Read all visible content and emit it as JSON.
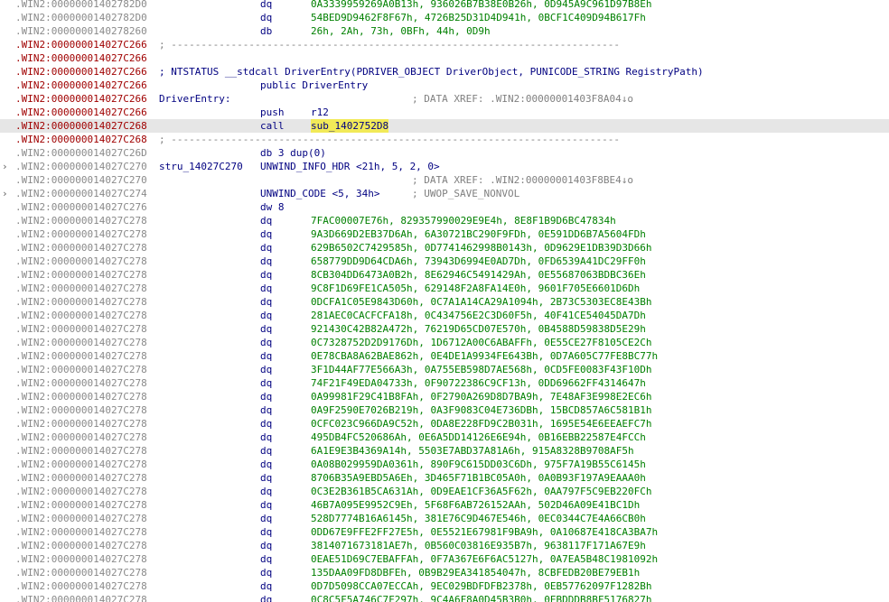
{
  "colors": {
    "background": "#ffffff",
    "address_gray": "#8a8a8a",
    "address_red": "#a00000",
    "code_navy": "#000080",
    "data_green": "#008000",
    "comment_gray": "#808080",
    "highlight_yellow": "#f2ea58",
    "current_line": "#e6e6e6"
  },
  "icons": {
    "expand": "chevron-right-icon"
  },
  "listing": [
    {
      "addr": ".WIN2:00000001402782D0",
      "mnem": "dq",
      "ops": "0A3339959269A0B13h, 936026B7B38E0B26h, 0D945A9C961D97B8Eh"
    },
    {
      "addr": ".WIN2:00000001402782D0",
      "mnem": "dq",
      "ops": "54BED9D9462F8F67h, 4726B25D31D4D941h, 0BCF1C409D94B617Fh"
    },
    {
      "addr": ".WIN2:0000000140278260",
      "mnem": "db",
      "ops": "26h, 2Ah, 73h, 0BFh, 44h, 0D9h"
    },
    {
      "addr": ".WIN2:000000014027C266",
      "addr_red": true,
      "label": "; ---------------------------------------------------------------------------",
      "label_comment": true
    },
    {
      "addr": ".WIN2:000000014027C266",
      "addr_red": true
    },
    {
      "addr": ".WIN2:000000014027C266",
      "addr_red": true,
      "label": "; NTSTATUS __stdcall DriverEntry(PDRIVER_OBJECT DriverObject, PUNICODE_STRING RegistryPath)"
    },
    {
      "addr": ".WIN2:000000014027C266",
      "addr_red": true,
      "mnem": "public DriverEntry"
    },
    {
      "addr": ".WIN2:000000014027C266",
      "addr_red": true,
      "label": "DriverEntry:",
      "cmt": "; DATA XREF: .WIN2:00000001403F8A04↓o"
    },
    {
      "addr": ".WIN2:000000014027C266",
      "addr_red": true,
      "mnem": "push",
      "ops": "r12",
      "ops_navy": true
    },
    {
      "addr": ".WIN2:000000014027C268",
      "addr_red": true,
      "mnem": "call",
      "ops": "sub_1402752D8",
      "ops_hl": true,
      "current": true
    },
    {
      "addr": ".WIN2:000000014027C268",
      "addr_red": true,
      "label": "; ---------------------------------------------------------------------------",
      "label_comment": true
    },
    {
      "addr": ".WIN2:000000014027C26D",
      "mnem": "db 3 dup(0)"
    },
    {
      "addr": ".WIN2:000000014027C270",
      "arrow": true,
      "label": "stru_14027C270",
      "mnem": "UNWIND_INFO_HDR <21h, 5, 2, 0>"
    },
    {
      "addr": ".WIN2:000000014027C270",
      "cmt": "; DATA XREF: .WIN2:00000001403F8BE4↓o"
    },
    {
      "addr": ".WIN2:000000014027C274",
      "arrow": true,
      "mnem": "UNWIND_CODE <5, 34h>",
      "cmt": "; UWOP_SAVE_NONVOL"
    },
    {
      "addr": ".WIN2:000000014027C276",
      "mnem": "dw 8"
    },
    {
      "addr": ".WIN2:000000014027C278",
      "mnem": "dq",
      "ops": "7FAC00007E76h, 829357990029E9E4h, 8E8F1B9D6BC47834h"
    },
    {
      "addr": ".WIN2:000000014027C278",
      "mnem": "dq",
      "ops": "9A3D669D2EB37D6Ah, 6A30721BC290F9FDh, 0E591DD6B7A5604FDh"
    },
    {
      "addr": ".WIN2:000000014027C278",
      "mnem": "dq",
      "ops": "629B6502C7429585h, 0D7741462998B0143h, 0D9629E1DB39D3D66h"
    },
    {
      "addr": ".WIN2:000000014027C278",
      "mnem": "dq",
      "ops": "658779DD9D64CDA6h, 73943D6994E0AD7Dh, 0FD6539A41DC29FF0h"
    },
    {
      "addr": ".WIN2:000000014027C278",
      "mnem": "dq",
      "ops": "8CB304DD6473A0B2h, 8E62946C5491429Ah, 0E55687063BDBC36Eh"
    },
    {
      "addr": ".WIN2:000000014027C278",
      "mnem": "dq",
      "ops": "9C8F1D69FE1CA505h, 629148F2A8FA14E0h, 9601F705E6601D6Dh"
    },
    {
      "addr": ".WIN2:000000014027C278",
      "mnem": "dq",
      "ops": "0DCFA1C05E9843D60h, 0C7A1A14CA29A1094h, 2B73C5303EC8E43Bh"
    },
    {
      "addr": ".WIN2:000000014027C278",
      "mnem": "dq",
      "ops": "281AEC0CACFCFA18h, 0C434756E2C3D60F5h, 40F41CE54045DA7Dh"
    },
    {
      "addr": ".WIN2:000000014027C278",
      "mnem": "dq",
      "ops": "921430C42B82A472h, 76219D65CD07E570h, 0B4588D59838D5E29h"
    },
    {
      "addr": ".WIN2:000000014027C278",
      "mnem": "dq",
      "ops": "0C7328752D2D9176Dh, 1D6712A00C6ABAFFh, 0E55CE27F8105CE2Ch"
    },
    {
      "addr": ".WIN2:000000014027C278",
      "mnem": "dq",
      "ops": "0E78CBA8A62BAE862h, 0E4DE1A9934FE643Bh, 0D7A605C77FE8BC77h"
    },
    {
      "addr": ".WIN2:000000014027C278",
      "mnem": "dq",
      "ops": "3F1D44AF77E566A3h, 0A755EB598D7AE568h, 0CD5FE0083F43F10Dh"
    },
    {
      "addr": ".WIN2:000000014027C278",
      "mnem": "dq",
      "ops": "74F21F49EDA04733h, 0F90722386C9CF13h, 0DD69662FF4314647h"
    },
    {
      "addr": ".WIN2:000000014027C278",
      "mnem": "dq",
      "ops": "0A99981F29C41B8FAh, 0F2790A269D8D7BA9h, 7E48AF3E998E2EC6h"
    },
    {
      "addr": ".WIN2:000000014027C278",
      "mnem": "dq",
      "ops": "0A9F2590E7026B219h, 0A3F9083C04E736DBh, 15BCD857A6C581B1h"
    },
    {
      "addr": ".WIN2:000000014027C278",
      "mnem": "dq",
      "ops": "0CFC023C966DA9C52h, 0DA8E228FD9C2B031h, 1695E54E6EEAEFC7h"
    },
    {
      "addr": ".WIN2:000000014027C278",
      "mnem": "dq",
      "ops": "495DB4FC520686Ah, 0E6A5DD14126E6E94h, 0B16EBB22587E4FCCh"
    },
    {
      "addr": ".WIN2:000000014027C278",
      "mnem": "dq",
      "ops": "6A1E9E3B4369A14h, 5503E7ABD37A81A6h, 915A8328B9708AF5h"
    },
    {
      "addr": ".WIN2:000000014027C278",
      "mnem": "dq",
      "ops": "0A08B029959DA0361h, 890F9C615DD03C6Dh, 975F7A19B55C6145h"
    },
    {
      "addr": ".WIN2:000000014027C278",
      "mnem": "dq",
      "ops": "8706B35A9EBD5A6Eh, 3D465F71B1BC05A0h, 0A0B93F197A9EAAA0h"
    },
    {
      "addr": ".WIN2:000000014027C278",
      "mnem": "dq",
      "ops": "0C3E2B361B5CA631Ah, 0D9EAE1CF36A5F62h, 0AA797F5C9EB220FCh"
    },
    {
      "addr": ".WIN2:000000014027C278",
      "mnem": "dq",
      "ops": "46B7A095E9952C9Eh, 5F68F6AB726152AAh, 502D46A09E41BC1Dh"
    },
    {
      "addr": ".WIN2:000000014027C278",
      "mnem": "dq",
      "ops": "528D7774B16A6145h, 381E76C9D467E546h, 0EC0344C7E4A66CB0h"
    },
    {
      "addr": ".WIN2:000000014027C278",
      "mnem": "dq",
      "ops": "0DD67E9FFE2FF27E5h, 0E5521E67981F9BA9h, 0A10687E418CA3BA7h"
    },
    {
      "addr": ".WIN2:000000014027C278",
      "mnem": "dq",
      "ops": "3814071673181AE7h, 0B560C03816E935B7h, 9638117F171A67E9h"
    },
    {
      "addr": ".WIN2:000000014027C278",
      "mnem": "dq",
      "ops": "0EAE51D69C7EBAFFAh, 0F7A367E6F6AC5127h, 0A7EA5B48C1981092h"
    },
    {
      "addr": ".WIN2:000000014027C278",
      "mnem": "dq",
      "ops": "135DAA09FD8DBFEh, 0B9B29EA341854047h, 8CBFEDB20BE79EB1h"
    },
    {
      "addr": ".WIN2:000000014027C278",
      "mnem": "dq",
      "ops": "0D7D5098CCA07ECCAh, 9EC029BDFDFB2378h, 0EB57762097F1282Bh"
    },
    {
      "addr": ".WIN2:000000014027C278",
      "mnem": "dq",
      "ops": "0C8C5F5A746C7F297h, 9C4A6F8A0D45B3B0h, 0EBDDDB8BF5176827h"
    }
  ]
}
